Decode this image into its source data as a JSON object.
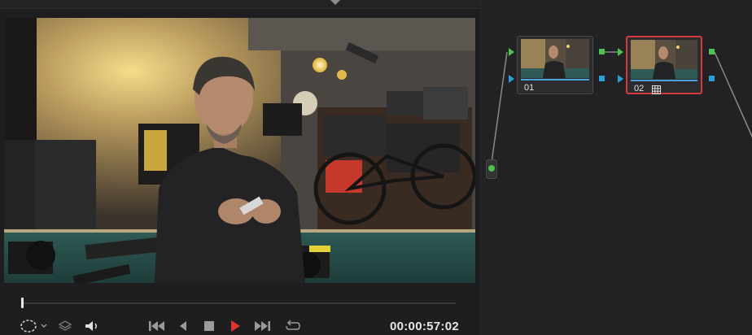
{
  "viewer": {
    "timecode": "00:00:57:02",
    "playback_progress": 0.0
  },
  "transport": {
    "icons": [
      "selection-icon",
      "dropdown-chevron-icon",
      "layers-icon",
      "volume-icon",
      "skip-to-start-icon",
      "step-back-icon",
      "stop-icon",
      "play-reverse-icon",
      "skip-to-end-icon",
      "loop-icon"
    ],
    "play_color": "#e0332f"
  },
  "nodes": [
    {
      "label": "01",
      "selected": false
    },
    {
      "label": "02",
      "selected": true,
      "badge_icon": "grid-icon"
    }
  ],
  "colors": {
    "input_port": "#4ec24e",
    "alpha_port": "#2aa0d8",
    "selected_border": "#d43a3a",
    "connection": "#8a8a8a"
  }
}
